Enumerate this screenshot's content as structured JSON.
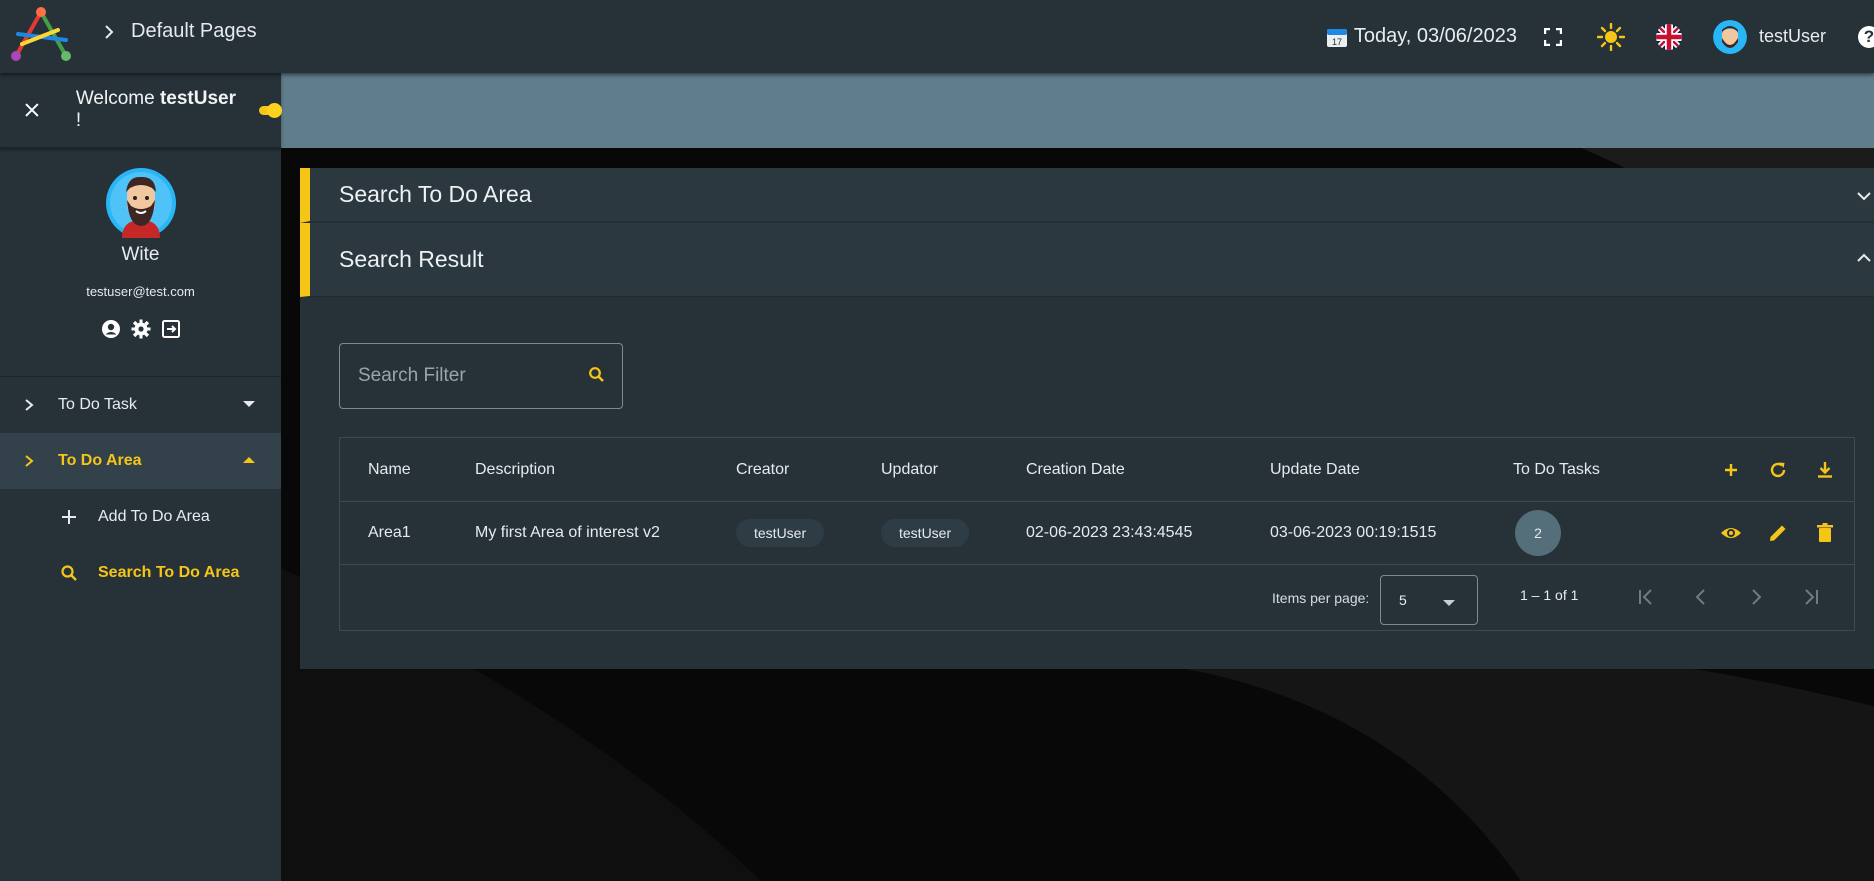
{
  "header": {
    "breadcrumb": "Default Pages",
    "today": "Today, 03/06/2023",
    "username": "testUser"
  },
  "sidebar": {
    "welcome_prefix": "Welcome",
    "welcome_user": "testUser",
    "welcome_suffix": "!",
    "profile_name": "Wite",
    "profile_email": "testuser@test.com",
    "menu": [
      {
        "label": "To Do Task",
        "expanded": false
      },
      {
        "label": "To Do Area",
        "expanded": true
      }
    ],
    "submenu": [
      {
        "label": "Add To Do Area",
        "icon": "plus-icon"
      },
      {
        "label": "Search To Do Area",
        "icon": "search-icon"
      }
    ]
  },
  "main": {
    "section_search": "Search To Do Area",
    "section_result": "Search Result",
    "search_placeholder": "Search Filter",
    "columns": [
      "Name",
      "Description",
      "Creator",
      "Updator",
      "Creation Date",
      "Update Date",
      "To Do Tasks"
    ],
    "rows": [
      {
        "name": "Area1",
        "description": "My first Area of interest v2",
        "creator": "testUser",
        "updator": "testUser",
        "creation_date": "02-06-2023 23:43:4545",
        "update_date": "03-06-2023 00:19:1515",
        "tasks": "2"
      }
    ],
    "paginator": {
      "items_per_page_label": "Items per page:",
      "items_per_page": "5",
      "range": "1 – 1 of 1"
    }
  },
  "colors": {
    "accent": "#f5c518",
    "surface": "#263238",
    "band": "#607d8b"
  }
}
